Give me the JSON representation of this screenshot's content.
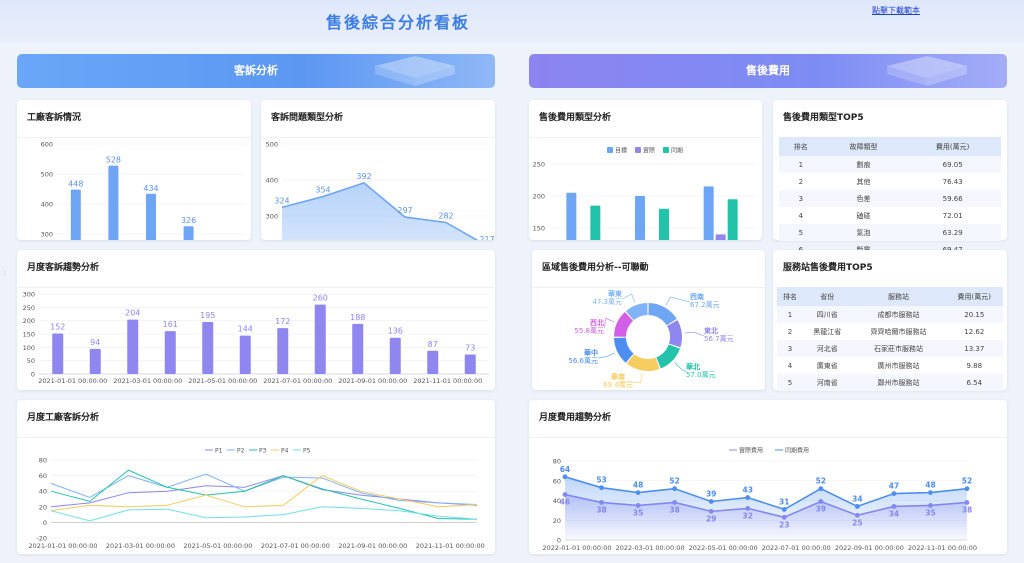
{
  "header": {
    "title": "售後綜合分析看板",
    "download_link": "點擊下載範本"
  },
  "banners": {
    "left": "客訴分析",
    "right": "售後費用"
  },
  "colors": {
    "blue": "#6ea6f5",
    "purple": "#8f86ef",
    "teal": "#22c3aa"
  },
  "cards": {
    "c1": "工廠客訴情況",
    "c2": "客訴問題類型分析",
    "c3": "售後費用類型分析",
    "c4": "售後費用類型TOP5",
    "c5": "月度客訴趨勢分析",
    "c6": "區域售後費用分析--可聯動",
    "c7": "服務站售後費用TOP5",
    "c8": "月度工廠客訴分析",
    "c9": "月度費用趨勢分析"
  },
  "table1": {
    "headers": [
      "排名",
      "故障類型",
      "費用(萬元)"
    ],
    "rows": [
      [
        "1",
        "劃痕",
        "69.05"
      ],
      [
        "2",
        "其他",
        "76.43"
      ],
      [
        "3",
        "色差",
        "59.66"
      ],
      [
        "4",
        "磕碰",
        "72.01"
      ],
      [
        "5",
        "氣泡",
        "63.29"
      ],
      [
        "6",
        "斷電",
        "69.47"
      ]
    ]
  },
  "table2": {
    "headers": [
      "排名",
      "省份",
      "服務站",
      "費用(萬元)"
    ],
    "rows": [
      [
        "1",
        "四川省",
        "成都市服務站",
        "20.15"
      ],
      [
        "2",
        "黑龍江省",
        "齊齊哈爾市服務站",
        "12.62"
      ],
      [
        "3",
        "河北省",
        "石家莊市服務站",
        "13.37"
      ],
      [
        "4",
        "廣東省",
        "廣州市服務站",
        "9.88"
      ],
      [
        "5",
        "河南省",
        "鄭州市服務站",
        "6.54"
      ]
    ]
  },
  "chart_data": [
    {
      "id": "factory",
      "type": "bar",
      "categories": [
        "P1",
        "P2",
        "P3",
        "P4",
        "P5"
      ],
      "values": [
        448,
        528,
        434,
        326,
        130
      ],
      "ylim": [
        0,
        600
      ],
      "yticks": [
        0,
        100,
        200,
        300,
        400,
        500,
        600
      ]
    },
    {
      "id": "complaint_type",
      "type": "area",
      "categories": [
        "劃痕",
        "其他",
        "色差",
        "磕碰",
        "氣泡",
        "斷電"
      ],
      "values": [
        324,
        354,
        392,
        297,
        282,
        217
      ],
      "ylim": [
        0,
        500
      ],
      "yticks": [
        0,
        100,
        200,
        300,
        400,
        500
      ]
    },
    {
      "id": "cost_type",
      "type": "bar",
      "categories": [
        "公司",
        "內銷",
        "外銷"
      ],
      "series": [
        {
          "name": "目標",
          "values": [
            205,
            200,
            215
          ]
        },
        {
          "name": "實際",
          "values": [
            130,
            130,
            140
          ]
        },
        {
          "name": "同期",
          "values": [
            185,
            180,
            195
          ]
        }
      ],
      "ylim": [
        0,
        250
      ],
      "yticks": [
        0,
        50,
        100,
        150,
        200,
        250
      ]
    },
    {
      "id": "monthly_complaint",
      "type": "bar",
      "categories": [
        "2021-01-01 00:00:00",
        "2021-02",
        "2021-03-01 00:00:00",
        "2021-04",
        "2021-05-01 00:00:00",
        "2021-06",
        "2021-07-01 00:00:00",
        "2021-08",
        "2021-09-01 00:00:00",
        "2021-10",
        "2021-11-01 00:00:00",
        "2021-12"
      ],
      "xticklabels": [
        "2021-01-01 00:00:00",
        "2021-03-01 00:00:00",
        "2021-05-01 00:00:00",
        "2021-07-01 00:00:00",
        "2021-09-01 00:00:00",
        "2021-11-01 00:00:00"
      ],
      "values": [
        152,
        94,
        204,
        161,
        195,
        144,
        172,
        260,
        188,
        136,
        87,
        73
      ],
      "ylim": [
        0,
        300
      ],
      "yticks": [
        0,
        50,
        100,
        150,
        200,
        250,
        300
      ]
    },
    {
      "id": "region_cost",
      "type": "pie",
      "slices": [
        {
          "name": "西南",
          "value": 67.2,
          "label": "67.2萬元",
          "color": "#6ea6f5"
        },
        {
          "name": "東北",
          "value": 56.7,
          "label": "56.7萬元",
          "color": "#8f86ef"
        },
        {
          "name": "華北",
          "value": 57.0,
          "label": "57.0萬元",
          "color": "#22c3aa"
        },
        {
          "name": "華南",
          "value": 69.4,
          "label": "69.4萬元",
          "color": "#f6cd5e"
        },
        {
          "name": "華中",
          "value": 56.6,
          "label": "56.6萬元",
          "color": "#4d8ef0"
        },
        {
          "name": "西北",
          "value": 55.8,
          "label": "55.8萬元",
          "color": "#d35ee8"
        },
        {
          "name": "華東",
          "value": 47.3,
          "label": "47.3萬元",
          "color": "#7fb2f7"
        }
      ]
    },
    {
      "id": "monthly_factory",
      "type": "line",
      "categories": [
        "2021-01",
        "2021-02",
        "2021-03",
        "2021-04",
        "2021-05",
        "2021-06",
        "2021-07",
        "2021-08",
        "2021-09",
        "2021-10",
        "2021-11",
        "2021-12"
      ],
      "xticklabels": [
        "2021-01-01 00:00:00",
        "2021-03-01 00:00:00",
        "2021-05-01 00:00:00",
        "2021-07-01 00:00:00",
        "2021-09-01 00:00:00",
        "2021-11-01 00:00:00"
      ],
      "series": [
        {
          "name": "P1",
          "values": [
            20,
            25,
            38,
            40,
            47,
            45,
            60,
            42,
            35,
            30,
            25,
            22
          ],
          "color": "#8f86ef"
        },
        {
          "name": "P2",
          "values": [
            50,
            32,
            60,
            45,
            62,
            40,
            58,
            57,
            38,
            28,
            25,
            23
          ],
          "color": "#7fb2f7"
        },
        {
          "name": "P3",
          "values": [
            40,
            27,
            67,
            45,
            35,
            40,
            60,
            43,
            30,
            18,
            5,
            4
          ],
          "color": "#22c3aa"
        },
        {
          "name": "P4",
          "values": [
            15,
            22,
            20,
            22,
            35,
            20,
            22,
            60,
            40,
            30,
            20,
            23
          ],
          "color": "#f6cd5e"
        },
        {
          "name": "P5",
          "values": [
            15,
            2,
            16,
            17,
            6,
            7,
            10,
            20,
            18,
            15,
            8,
            4
          ],
          "color": "#6fe0e8"
        }
      ],
      "ylim": [
        -20,
        80
      ],
      "yticks": [
        -20,
        0,
        20,
        40,
        60,
        80
      ]
    },
    {
      "id": "monthly_cost",
      "type": "line",
      "categories": [
        "2022-01",
        "2022-02",
        "2022-03",
        "2022-04",
        "2022-05",
        "2022-06",
        "2022-07",
        "2022-08",
        "2022-09",
        "2022-10",
        "2022-11",
        "2022-12"
      ],
      "xticklabels": [
        "2022-01-01 00:00:00",
        "2022-03-01 00:00:00",
        "2022-05-01 00:00:00",
        "2022-07-01 00:00:00",
        "2022-09-01 00:00:00",
        "2022-11-01 00:00:00"
      ],
      "series": [
        {
          "name": "實際費用",
          "values": [
            46,
            38,
            35,
            38,
            29,
            32,
            23,
            39,
            25,
            34,
            35,
            38
          ],
          "color": "#8f86ef"
        },
        {
          "name": "同期費用",
          "values": [
            64,
            53,
            48,
            52,
            39,
            43,
            31,
            52,
            34,
            47,
            48,
            52
          ],
          "color": "#4d8ef0"
        }
      ],
      "ylim": [
        0,
        80
      ],
      "yticks": [
        0,
        20,
        40,
        60,
        80
      ]
    }
  ]
}
